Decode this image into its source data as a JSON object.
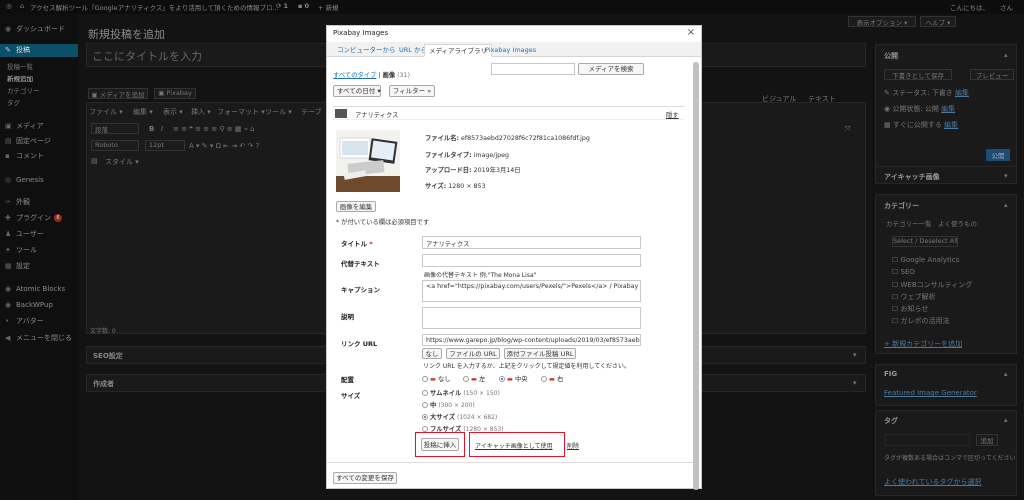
{
  "adminbar": {
    "site_title": "アクセス解析ツール『Googleアナリティクス』をより活用して頂くための情報ブロ...",
    "updates": "1",
    "comments": "0",
    "new_label": "+ 新規",
    "greeting": "こんにちは、",
    "user": "さん"
  },
  "sidebar": {
    "dashboard": "ダッシュボード",
    "posts": "投稿",
    "posts_sub": [
      "投稿一覧",
      "新規追加",
      "カテゴリー",
      "タグ"
    ],
    "media": "メディア",
    "pages": "固定ページ",
    "comments": "コメント",
    "genesis": "Genesis",
    "appearance": "外観",
    "plugins": "プラグイン",
    "plugins_count": "6",
    "users": "ユーザー",
    "tools": "ツール",
    "settings": "設定",
    "atomic": "Atomic Blocks",
    "backwpup": "BackWPup",
    "avatar": "アバター",
    "collapse": "メニューを閉じる"
  },
  "editor": {
    "screen_options": "表示オプション ▾",
    "help": "ヘルプ ▾",
    "page_title": "新規投稿を追加",
    "title_placeholder": "ここにタイトルを入力",
    "add_media": "メディアを追加",
    "pixabay": "Pixabay",
    "visual": "ビジュアル",
    "text": "テキスト",
    "menu": [
      "ファイル ▾",
      "編集 ▾",
      "表示 ▾",
      "挿入 ▾",
      "フォーマット ▾",
      "ツール ▾",
      "テーブ"
    ],
    "format_select": "段落",
    "font_select": "Roboto",
    "size_select": "12pt",
    "style_label": "スタイル ▾",
    "word_count": "文字数: 0",
    "seo_box": "SEO設定",
    "author_box": "作成者"
  },
  "right_col": {
    "publish": "公開",
    "save_draft": "下書きとして保存",
    "preview": "プレビュー",
    "status_label": "ステータス: 下書き",
    "status_edit": "編集",
    "visibility_label": "公開状態: 公開",
    "visibility_edit": "編集",
    "schedule_label": "すぐに公開する",
    "schedule_edit": "編集",
    "publish_btn": "公開",
    "eyecatch": "アイキャッチ画像",
    "category": "カテゴリー",
    "category_tabs": "カテゴリー一覧　よく使うもの",
    "select_deselect": "Select / Deselect All",
    "categories": [
      "Google Analytics",
      "SEO",
      "WEBコンサルティング",
      "ウェブ解析",
      "お知らせ",
      "ガレポの活用法"
    ],
    "add_category": "+ 新規カテゴリーを追加",
    "fig": "FIG",
    "fig_link": "Featured Image Generator",
    "tag": "タグ",
    "tag_add": "追加",
    "tag_help": "タグが複数ある場合はコンマで区切ってください",
    "tag_popular": "よく使われているタグから選択"
  },
  "modal": {
    "title": "Pixabay Images",
    "close": "×",
    "tabs": [
      "コンピューターから",
      "URL から",
      "メディアライブラリ",
      "Pixabay Images"
    ],
    "active_tab": 2,
    "filter_all_types": "すべてのタイプ",
    "filter_images": "画像",
    "filter_count": "(31)",
    "search_placeholder": "",
    "search_button": "メディアを検索",
    "date_select": "すべての日付 ▾",
    "filter_button": "フィルター »",
    "item_title": "アナリティクス",
    "hide_link": "隠す",
    "meta": {
      "filename_label": "ファイル名:",
      "filename": "ef8573aebd27028f6c72f81ca1086fdf.jpg",
      "filetype_label": "ファイルタイプ:",
      "filetype": "image/jpeg",
      "upload_label": "アップロード日:",
      "upload_date": "2019年3月14日",
      "size_label": "サイズ:",
      "size": "1280 × 853"
    },
    "edit_image": "画像を編集",
    "required_note": "* が付いている欄は必須項目です",
    "labels": {
      "title": "タイトル",
      "alt": "代替テキスト",
      "caption": "キャプション",
      "description": "説明",
      "link_url": "リンク URL",
      "align": "配置",
      "size": "サイズ"
    },
    "title_value": "アナリティクス",
    "alt_value": "",
    "alt_help": "画像の代替テキスト 例:\"The Mona Lisa\"",
    "caption_value": "<a href=\"https://pixabay.com/users/Pexels/\">Pexels</a> / Pixabay",
    "description_value": "",
    "link_value": "https://www.garepo.jp/blog/wp-content/uploads/2019/03/ef8573aebd27",
    "link_buttons": [
      "なし",
      "ファイルの URL",
      "添付ファイル投稿 URL"
    ],
    "link_help": "リンク URL を入力するか、上記をクリックして規定値を利用してください。",
    "align_options": [
      "なし",
      "左",
      "中央",
      "右"
    ],
    "align_selected": 2,
    "size_options": [
      {
        "label": "サムネイル",
        "dims": "(150 × 150)"
      },
      {
        "label": "中",
        "dims": "(300 × 200)"
      },
      {
        "label": "大サイズ",
        "dims": "(1024 × 682)"
      },
      {
        "label": "フルサイズ",
        "dims": "(1280 × 853)"
      }
    ],
    "size_selected": 2,
    "insert_button": "投稿に挿入",
    "eyecatch_link": "アイキャッチ画像として使用",
    "delete_link": "削除",
    "save_all": "すべての変更を保存"
  },
  "colors": {
    "highlight": "#e0142a",
    "link": "#2271b1",
    "sidebar_active": "#0b4f68",
    "publish_button": "#1b6bb0"
  }
}
